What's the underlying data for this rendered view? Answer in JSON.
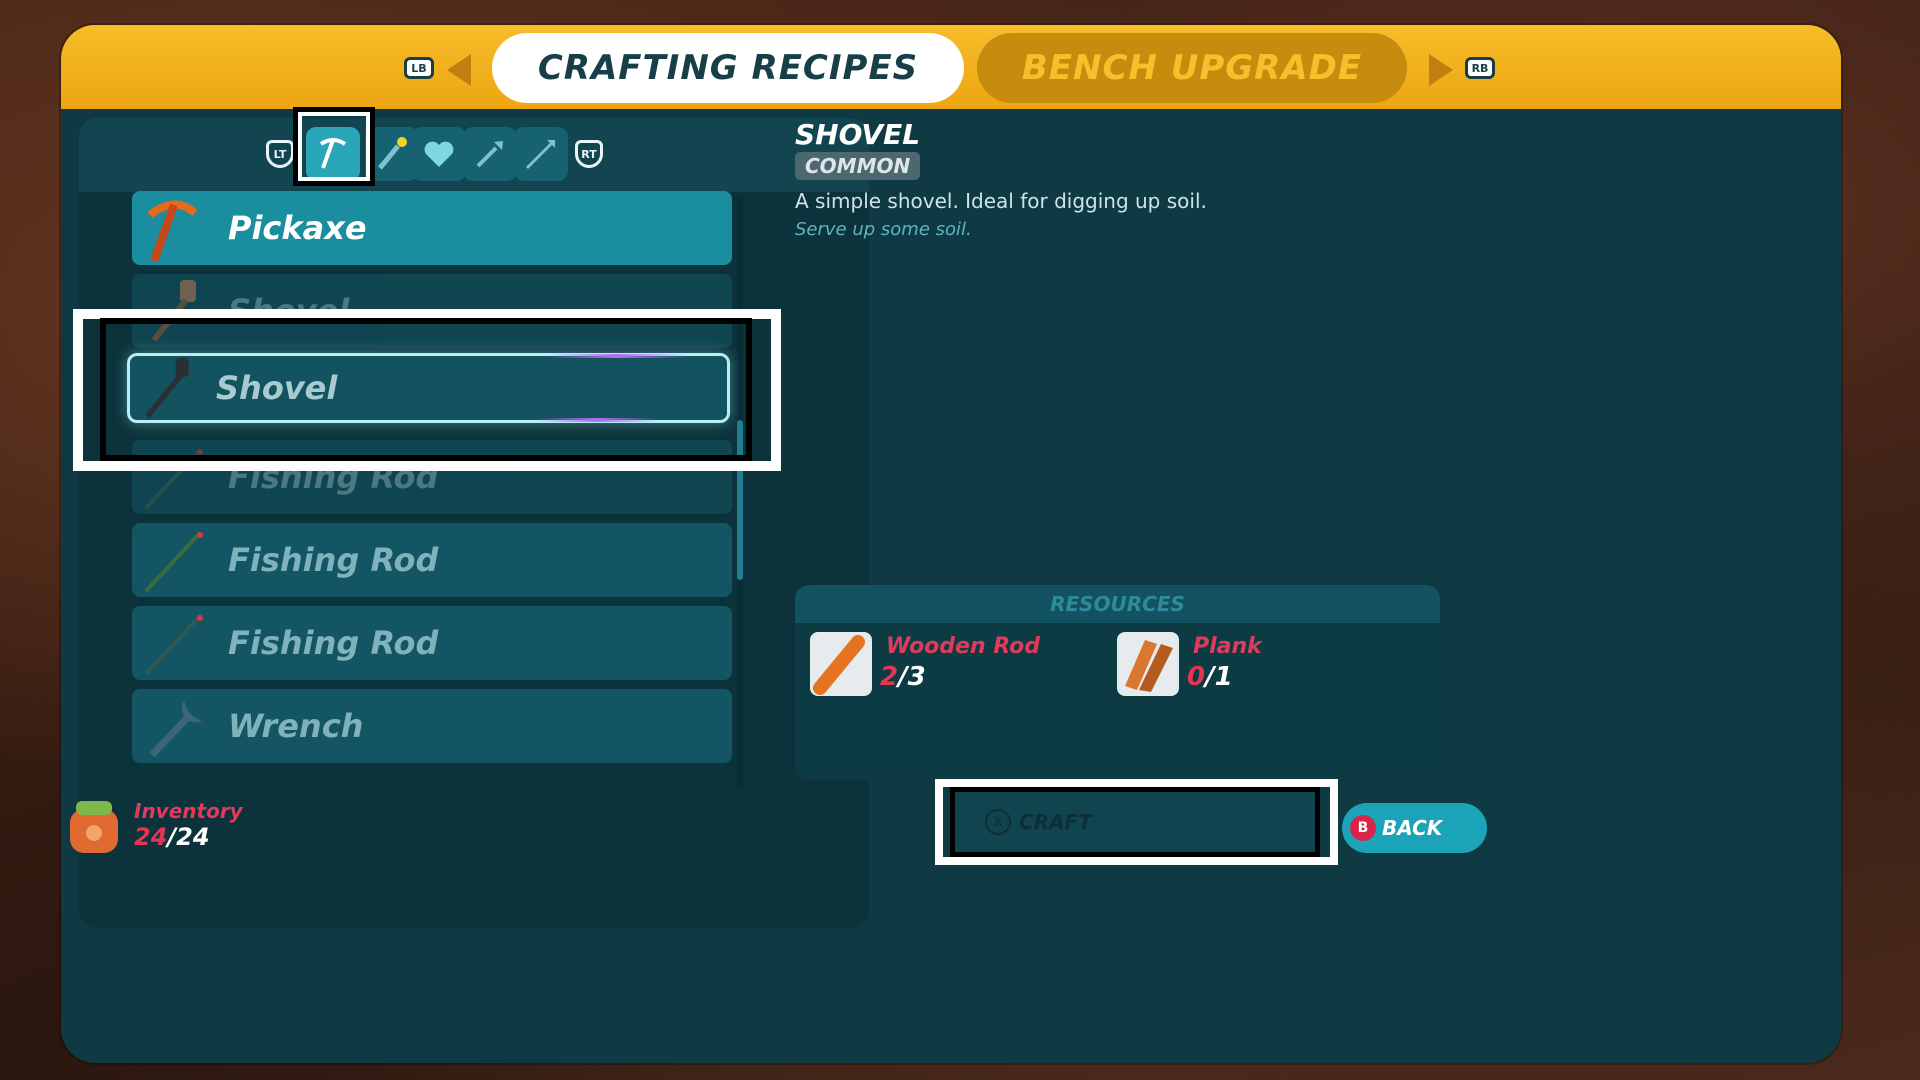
{
  "header": {
    "lb": "LB",
    "rb": "RB",
    "tab_active": "CRAFTING RECIPES",
    "tab_inactive": "BENCH UPGRADE"
  },
  "categories": {
    "lt": "LT",
    "rt": "RT",
    "icons": [
      "pickaxe-icon",
      "torch-icon",
      "heart-icon",
      "spear-icon",
      "arrow-icon"
    ],
    "active_index": 0
  },
  "recipes": [
    {
      "label": "Pickaxe",
      "icon": "pickaxe-icon",
      "state": "active"
    },
    {
      "label": "Shovel",
      "icon": "shovel-icon",
      "state": "partial"
    },
    {
      "label": "Shovel",
      "icon": "shovel-icon",
      "state": "selected"
    },
    {
      "label": "Fishing Rod",
      "icon": "fishing-rod-icon",
      "state": "partial"
    },
    {
      "label": "Fishing Rod",
      "icon": "fishing-rod-icon",
      "state": "locked"
    },
    {
      "label": "Fishing Rod",
      "icon": "fishing-rod-icon",
      "state": "locked"
    },
    {
      "label": "Wrench",
      "icon": "wrench-icon",
      "state": "locked"
    }
  ],
  "detail": {
    "title": "SHOVEL",
    "rarity": "COMMON",
    "description": "A simple shovel. Ideal for digging up soil.",
    "flavor": "Serve up some soil."
  },
  "resources": {
    "header": "RESOURCES",
    "items": [
      {
        "name": "Wooden Rod",
        "have": "2",
        "need": "/3",
        "icon": "wooden-rod-icon"
      },
      {
        "name": "Plank",
        "have": "0",
        "need": "/1",
        "icon": "plank-icon"
      }
    ]
  },
  "inventory": {
    "label": "Inventory",
    "have": "24",
    "capacity": "/24"
  },
  "actions": {
    "craft_button": "X",
    "craft_label": "CRAFT",
    "back_button": "B",
    "back_label": "BACK"
  },
  "colors": {
    "accent_yellow": "#f2b21c",
    "panel_teal": "#0f3a43",
    "selected_teal": "#1a8d9e",
    "alert_red": "#e23a5a"
  }
}
